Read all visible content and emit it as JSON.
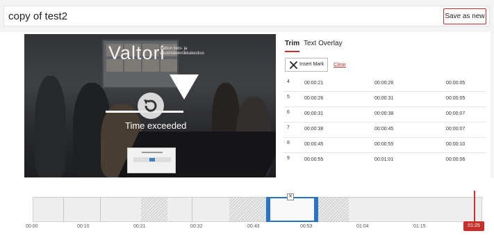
{
  "header": {
    "title": "copy of test2",
    "save_label": "Save as new"
  },
  "video": {
    "logo_text": "Valtori",
    "logo_subtitle": "Valtion tieto- ja viestintätekniikkakeskus",
    "status_text": "Time exceeded",
    "icons": [
      "replay-icon",
      "play-triangle-icon"
    ]
  },
  "panel": {
    "tabs": [
      {
        "label": "Trim",
        "active": true
      },
      {
        "label": "Text Overlay",
        "active": false
      }
    ],
    "insert_mark_label": "Insert Mark",
    "clear_label": "Clear",
    "marks": [
      {
        "index": "4",
        "start": "00:00:21",
        "end": "00:00:26",
        "duration": "00:00:05"
      },
      {
        "index": "5",
        "start": "00:00:26",
        "end": "00:00:31",
        "duration": "00:00:05"
      },
      {
        "index": "6",
        "start": "00:00:31",
        "end": "00:00:38",
        "duration": "00:00:07"
      },
      {
        "index": "7",
        "start": "00:00:38",
        "end": "00:00:45",
        "duration": "00:00:07"
      },
      {
        "index": "8",
        "start": "00:00:45",
        "end": "00:00:55",
        "duration": "00:00:10"
      },
      {
        "index": "9",
        "start": "00:00:55",
        "end": "00:01:01",
        "duration": "00:00:06"
      }
    ]
  },
  "timeline": {
    "ticks": [
      "00:00",
      "00:10",
      "00:21",
      "00:32",
      "00:43",
      "00:53",
      "01:04",
      "01:15"
    ],
    "current_time": "01:25",
    "accent": "#2a73c4",
    "playhead_color": "#d0312d"
  }
}
